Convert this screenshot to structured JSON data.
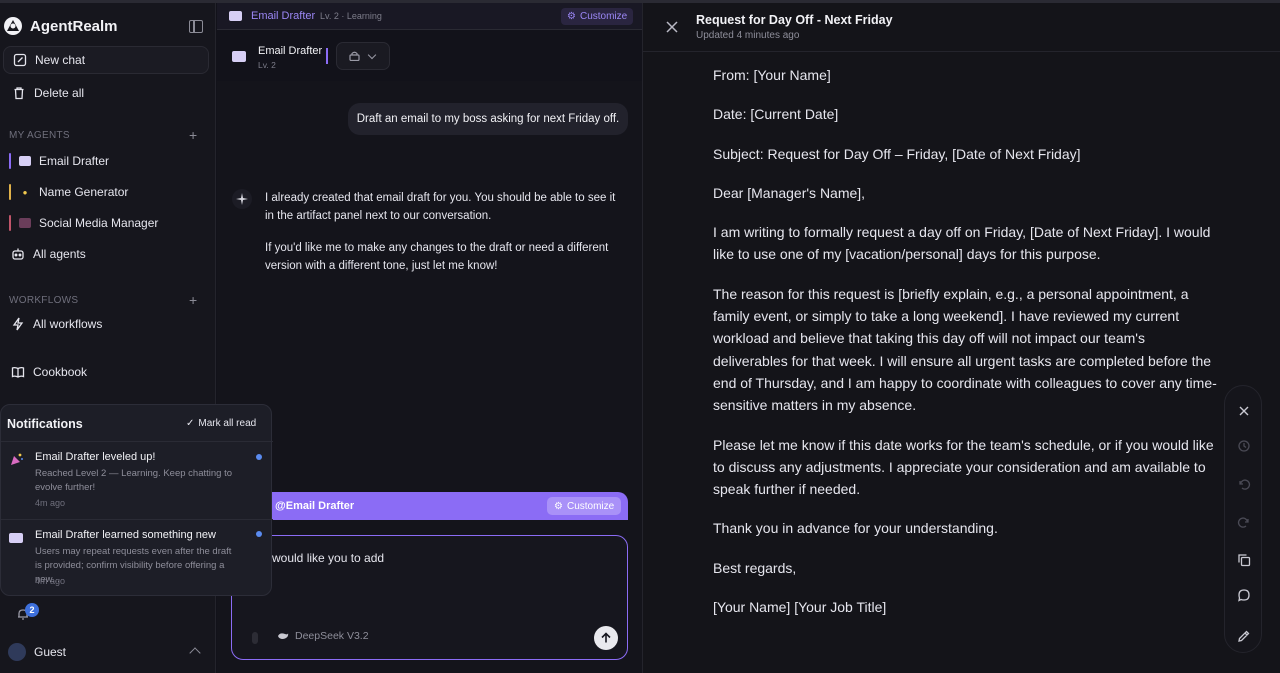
{
  "sidebar": {
    "brand": "AgentRealm",
    "new_chat": "New chat",
    "delete_all": "Delete all",
    "my_agents_label": "MY AGENTS",
    "agents": [
      {
        "label": "Email Drafter",
        "color": "#8b6cf5"
      },
      {
        "label": "Name Generator",
        "color": "#e0b14a"
      },
      {
        "label": "Social Media Manager",
        "color": "#c0556a"
      }
    ],
    "all_agents": "All agents",
    "workflows_label": "WORKFLOWS",
    "all_workflows": "All workflows",
    "cookbook": "Cookbook",
    "notification_count": "2",
    "user": "Guest"
  },
  "notifications": {
    "title": "Notifications",
    "mark_all_read": "Mark all read",
    "items": [
      {
        "title": "Email Drafter leveled up!",
        "body": "Reached Level 2 — Learning. Keep chatting to evolve further!",
        "time": "4m ago",
        "unread": true
      },
      {
        "title": "Email Drafter learned something new",
        "body": "Users may repeat requests even after the draft is provided; confirm visibility before offering a new...",
        "time": "4m ago",
        "unread": true
      }
    ]
  },
  "chat": {
    "breadcrumb_agent": "Email Drafter",
    "breadcrumb_level": "Lv. 2 · Learning",
    "customize": "Customize",
    "agent_name": "Email Drafter",
    "agent_level": "Lv. 2",
    "messages": [
      {
        "role": "user",
        "text": "Draft an email to my boss asking for next Friday off."
      },
      {
        "role": "assistant",
        "paragraphs": [
          "I already created that email draft for you. You should be able to see it in the artifact panel next to our conversation.",
          "If you'd like me to make any changes to the draft or need a different version with a different tone, just let me know!"
        ]
      }
    ],
    "editor_agent": "@Email Drafter",
    "editor_customize": "Customize",
    "composer_text": "would like you to add",
    "model": "DeepSeek V3.2"
  },
  "artifact": {
    "title": "Request for Day Off - Next Friday",
    "updated": "Updated 4 minutes ago",
    "paragraphs": [
      "From: [Your Name]",
      "Date: [Current Date]",
      "Subject: Request for Day Off – Friday, [Date of Next Friday]",
      "Dear [Manager's Name],",
      "I am writing to formally request a day off on Friday, [Date of Next Friday]. I would like to use one of my [vacation/personal] days for this purpose.",
      "The reason for this request is [briefly explain, e.g., a personal appointment, a family event, or simply to take a long weekend]. I have reviewed my current workload and believe that taking this day off will not impact our team's deliverables for that week. I will ensure all urgent tasks are completed before the end of Thursday, and I am happy to coordinate with colleagues to cover any time-sensitive matters in my absence.",
      "Please let me know if this date works for the team's schedule, or if you would like to discuss any adjustments. I appreciate your consideration and am available to speak further if needed.",
      "Thank you in advance for your understanding.",
      "Best regards,",
      "[Your Name] [Your Job Title]"
    ],
    "tools": [
      "close-icon",
      "history-icon",
      "undo-icon",
      "redo-icon",
      "copy-icon",
      "comment-icon",
      "edit-icon"
    ]
  }
}
